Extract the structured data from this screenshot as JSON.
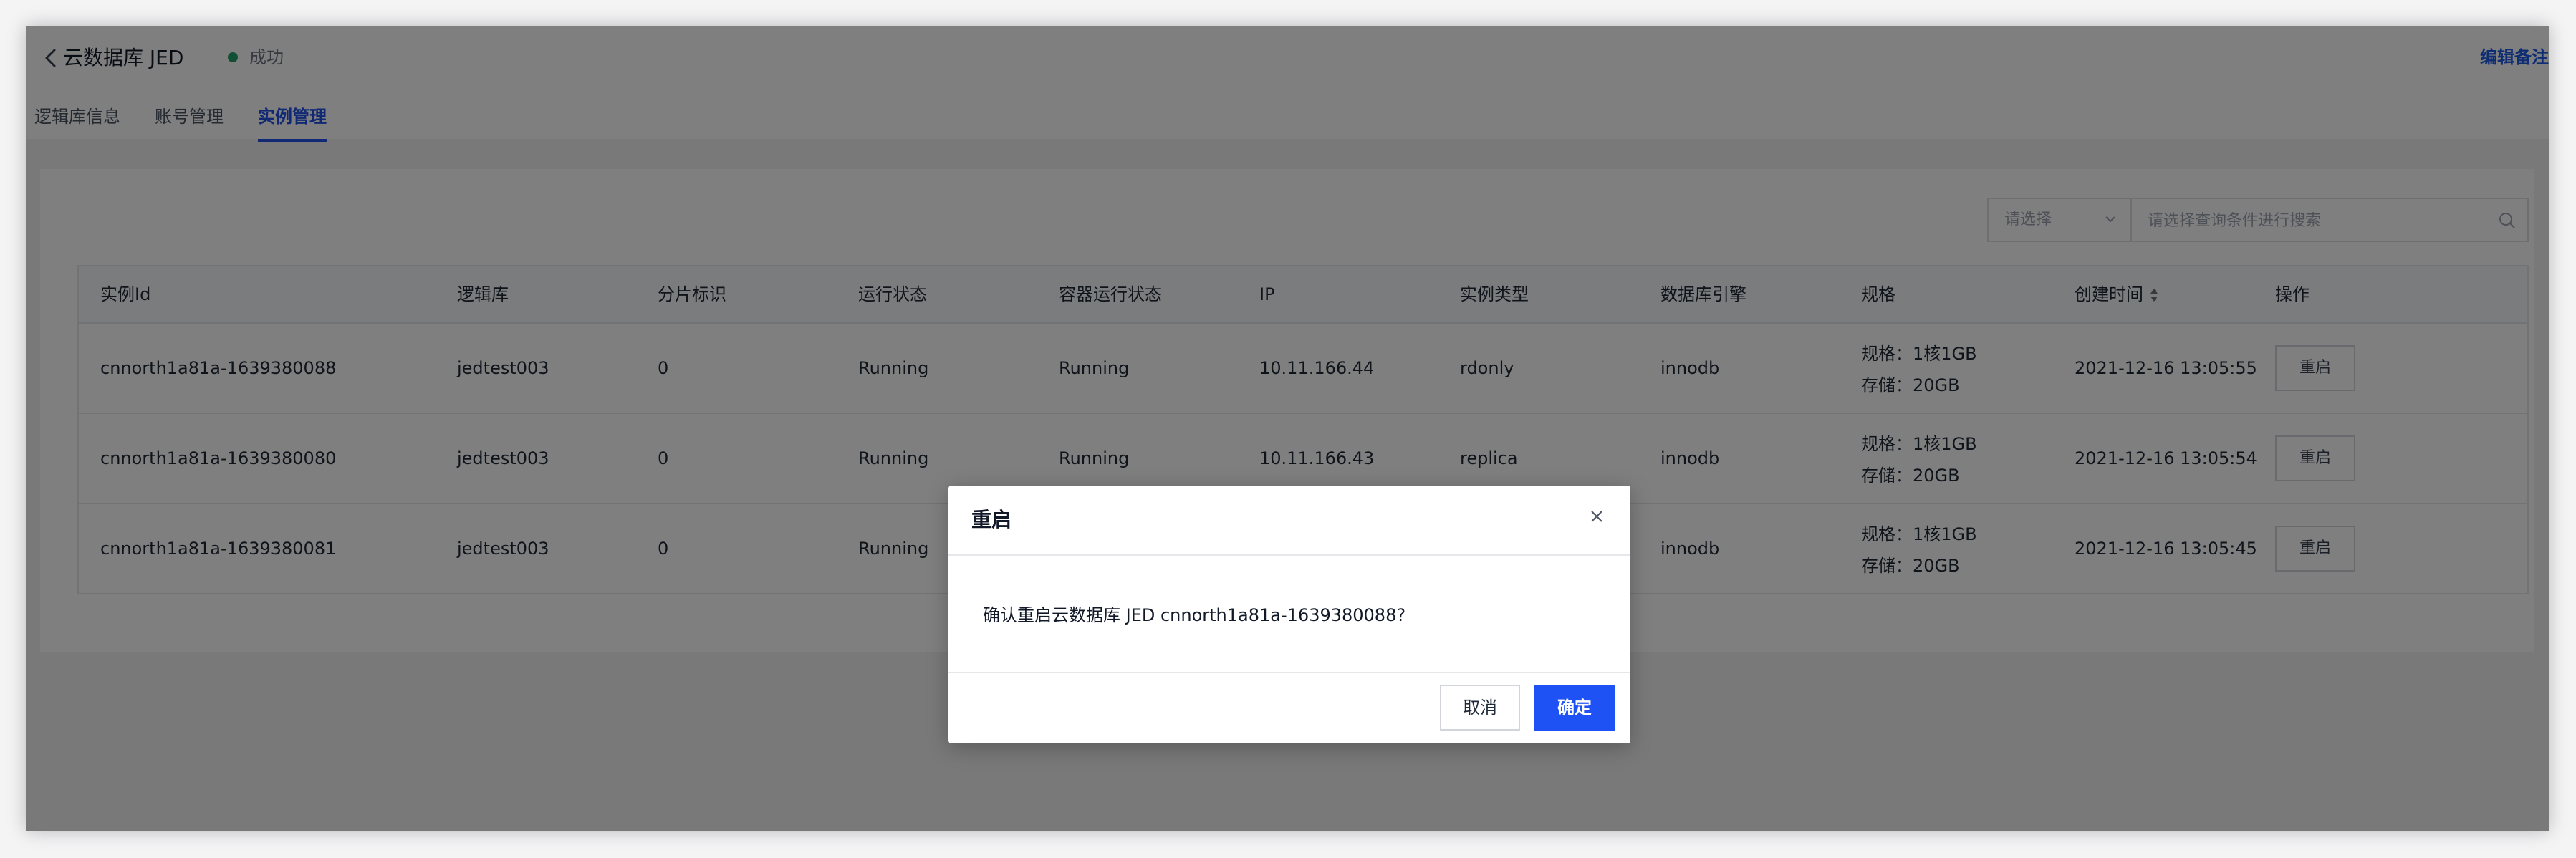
{
  "header": {
    "title": "云数据库 JED",
    "status": "成功",
    "edit_note": "编辑备注",
    "back_icon": "chevron-left-icon",
    "status_color": "#22a06b"
  },
  "tabs": [
    {
      "label": "逻辑库信息",
      "active": false
    },
    {
      "label": "账号管理",
      "active": false
    },
    {
      "label": "实例管理",
      "active": true
    }
  ],
  "filter": {
    "select_placeholder": "请选择",
    "search_placeholder": "请选择查询条件进行搜索"
  },
  "table": {
    "columns": [
      "实例Id",
      "逻辑库",
      "分片标识",
      "运行状态",
      "容器运行状态",
      "IP",
      "实例类型",
      "数据库引擎",
      "规格",
      "创建时间",
      "操作"
    ],
    "rows": [
      {
        "id": "cnnorth1a81a-1639380088",
        "db": "jedtest003",
        "shard": "0",
        "status": "Running",
        "container_status": "Running",
        "ip": "10.11.166.44",
        "type": "rdonly",
        "engine": "innodb",
        "spec": "规格：1核1GB",
        "storage": "存储：20GB",
        "created": "2021-12-16 13:05:55",
        "action": "重启"
      },
      {
        "id": "cnnorth1a81a-1639380080",
        "db": "jedtest003",
        "shard": "0",
        "status": "Running",
        "container_status": "Running",
        "ip": "10.11.166.43",
        "type": "replica",
        "engine": "innodb",
        "spec": "规格：1核1GB",
        "storage": "存储：20GB",
        "created": "2021-12-16 13:05:54",
        "action": "重启"
      },
      {
        "id": "cnnorth1a81a-1639380081",
        "db": "jedtest003",
        "shard": "0",
        "status": "Running",
        "container_status": "",
        "ip": "",
        "type": "",
        "engine": "innodb",
        "spec": "规格：1核1GB",
        "storage": "存储：20GB",
        "created": "2021-12-16 13:05:45",
        "action": "重启"
      }
    ]
  },
  "modal": {
    "title": "重启",
    "message": "确认重启云数据库 JED cnnorth1a81a-1639380088?",
    "cancel": "取消",
    "confirm": "确定",
    "close_icon": "close-icon",
    "primary_color": "#1e52f5"
  }
}
